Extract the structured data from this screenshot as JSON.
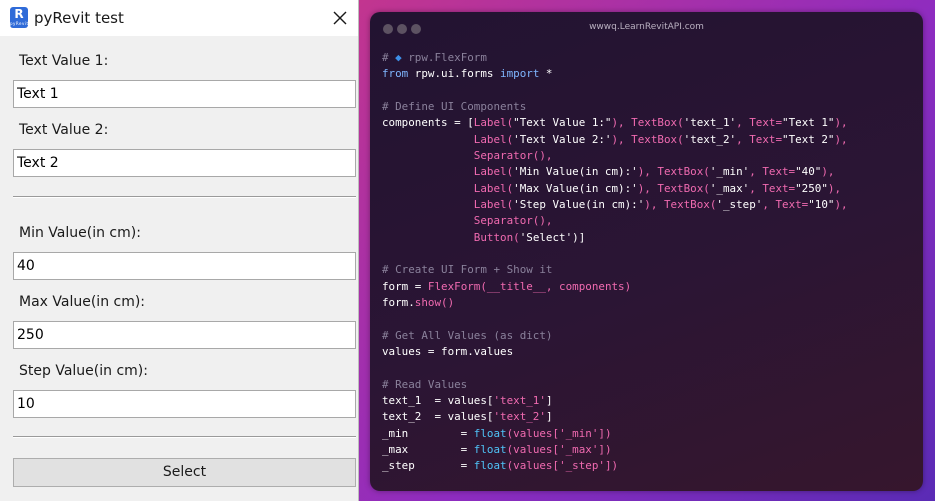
{
  "dialog": {
    "title": "pyRevit test",
    "icon_letter": "R",
    "icon_subtext": "pyRevit",
    "fields": [
      {
        "label": "Text Value 1:",
        "value": "Text 1"
      },
      {
        "label": "Text Value 2:",
        "value": "Text 2"
      },
      {
        "label": "Min Value(in cm):",
        "value": "40"
      },
      {
        "label": "Max Value(in cm):",
        "value": "250"
      },
      {
        "label": "Step Value(in cm):",
        "value": "10"
      }
    ],
    "button_label": "Select"
  },
  "code_panel": {
    "url": "wwwq.LearnRevitAPI.com",
    "lines": [
      [
        {
          "t": "# ",
          "c": "cm"
        },
        {
          "t": "◆",
          "c": "diamond"
        },
        {
          "t": " rpw.FlexForm",
          "c": "cm"
        }
      ],
      [
        {
          "t": "from",
          "c": "kw"
        },
        {
          "t": " rpw.ui.forms ",
          "c": "st"
        },
        {
          "t": "import",
          "c": "kw"
        },
        {
          "t": " *",
          "c": "st"
        }
      ],
      [],
      [
        {
          "t": "# Define UI Components",
          "c": "cm"
        }
      ],
      [
        {
          "t": "components = [",
          "c": "st"
        },
        {
          "t": "Label(",
          "c": "fn"
        },
        {
          "t": "\"Text Value 1:\"",
          "c": "st"
        },
        {
          "t": "), ",
          "c": "fn"
        },
        {
          "t": "TextBox(",
          "c": "fn"
        },
        {
          "t": "'text_1'",
          "c": "st"
        },
        {
          "t": ", ",
          "c": "fn"
        },
        {
          "t": "Text=",
          "c": "fn"
        },
        {
          "t": "\"Text 1\"",
          "c": "st"
        },
        {
          "t": "),",
          "c": "fn"
        }
      ],
      [
        {
          "t": "              ",
          "c": "st"
        },
        {
          "t": "Label(",
          "c": "fn"
        },
        {
          "t": "'Text Value 2:'",
          "c": "st"
        },
        {
          "t": "), ",
          "c": "fn"
        },
        {
          "t": "TextBox(",
          "c": "fn"
        },
        {
          "t": "'text_2'",
          "c": "st"
        },
        {
          "t": ", ",
          "c": "fn"
        },
        {
          "t": "Text=",
          "c": "fn"
        },
        {
          "t": "\"Text 2\"",
          "c": "st"
        },
        {
          "t": "),",
          "c": "fn"
        }
      ],
      [
        {
          "t": "              ",
          "c": "st"
        },
        {
          "t": "Separator(),",
          "c": "fn"
        }
      ],
      [
        {
          "t": "              ",
          "c": "st"
        },
        {
          "t": "Label(",
          "c": "fn"
        },
        {
          "t": "'Min Value(in cm):'",
          "c": "st"
        },
        {
          "t": "), ",
          "c": "fn"
        },
        {
          "t": "TextBox(",
          "c": "fn"
        },
        {
          "t": "'_min'",
          "c": "st"
        },
        {
          "t": ", ",
          "c": "fn"
        },
        {
          "t": "Text=",
          "c": "fn"
        },
        {
          "t": "\"40\"",
          "c": "st"
        },
        {
          "t": "),",
          "c": "fn"
        }
      ],
      [
        {
          "t": "              ",
          "c": "st"
        },
        {
          "t": "Label(",
          "c": "fn"
        },
        {
          "t": "'Max Value(in cm):'",
          "c": "st"
        },
        {
          "t": "), ",
          "c": "fn"
        },
        {
          "t": "TextBox(",
          "c": "fn"
        },
        {
          "t": "'_max'",
          "c": "st"
        },
        {
          "t": ", ",
          "c": "fn"
        },
        {
          "t": "Text=",
          "c": "fn"
        },
        {
          "t": "\"250\"",
          "c": "st"
        },
        {
          "t": "),",
          "c": "fn"
        }
      ],
      [
        {
          "t": "              ",
          "c": "st"
        },
        {
          "t": "Label(",
          "c": "fn"
        },
        {
          "t": "'Step Value(in cm):'",
          "c": "st"
        },
        {
          "t": "), ",
          "c": "fn"
        },
        {
          "t": "TextBox(",
          "c": "fn"
        },
        {
          "t": "'_step'",
          "c": "st"
        },
        {
          "t": ", ",
          "c": "fn"
        },
        {
          "t": "Text=",
          "c": "fn"
        },
        {
          "t": "\"10\"",
          "c": "st"
        },
        {
          "t": "),",
          "c": "fn"
        }
      ],
      [
        {
          "t": "              ",
          "c": "st"
        },
        {
          "t": "Separator(),",
          "c": "fn"
        }
      ],
      [
        {
          "t": "              ",
          "c": "st"
        },
        {
          "t": "Button(",
          "c": "fn"
        },
        {
          "t": "'Select'",
          "c": "st"
        },
        {
          "t": ")]",
          "c": "st"
        }
      ],
      [],
      [
        {
          "t": "# Create UI Form + Show it",
          "c": "cm"
        }
      ],
      [
        {
          "t": "form = ",
          "c": "st"
        },
        {
          "t": "FlexForm(__title__, components)",
          "c": "fn"
        }
      ],
      [
        {
          "t": "form.",
          "c": "st"
        },
        {
          "t": "show()",
          "c": "fn"
        }
      ],
      [],
      [
        {
          "t": "# Get All Values (as dict)",
          "c": "cm"
        }
      ],
      [
        {
          "t": "values = form.values",
          "c": "st"
        }
      ],
      [],
      [
        {
          "t": "# Read Values",
          "c": "cm"
        }
      ],
      [
        {
          "t": "text_1  = values[",
          "c": "st"
        },
        {
          "t": "'text_1'",
          "c": "fn"
        },
        {
          "t": "]",
          "c": "st"
        }
      ],
      [
        {
          "t": "text_2  = values[",
          "c": "st"
        },
        {
          "t": "'text_2'",
          "c": "fn"
        },
        {
          "t": "]",
          "c": "st"
        }
      ],
      [
        {
          "t": "_min        = ",
          "c": "st"
        },
        {
          "t": "float",
          "c": "bi"
        },
        {
          "t": "(values[",
          "c": "fn"
        },
        {
          "t": "'_min'",
          "c": "fn"
        },
        {
          "t": "])",
          "c": "fn"
        }
      ],
      [
        {
          "t": "_max        = ",
          "c": "st"
        },
        {
          "t": "float",
          "c": "bi"
        },
        {
          "t": "(values[",
          "c": "fn"
        },
        {
          "t": "'_max'",
          "c": "fn"
        },
        {
          "t": "])",
          "c": "fn"
        }
      ],
      [
        {
          "t": "_step       = ",
          "c": "st"
        },
        {
          "t": "float",
          "c": "bi"
        },
        {
          "t": "(values[",
          "c": "fn"
        },
        {
          "t": "'_step'",
          "c": "fn"
        },
        {
          "t": "])",
          "c": "fn"
        }
      ]
    ]
  },
  "colors": {
    "accent": "#2f6bd8",
    "comment": "#8a819b",
    "keyword": "#7fb6ff",
    "function": "#f06ab0",
    "builtin": "#4fc3f7",
    "gradient_start": "#c2358f",
    "gradient_end": "#5a2bb5"
  },
  "icons": [
    "app-icon",
    "close-icon",
    "window-dot-icon",
    "diamond-icon"
  ]
}
